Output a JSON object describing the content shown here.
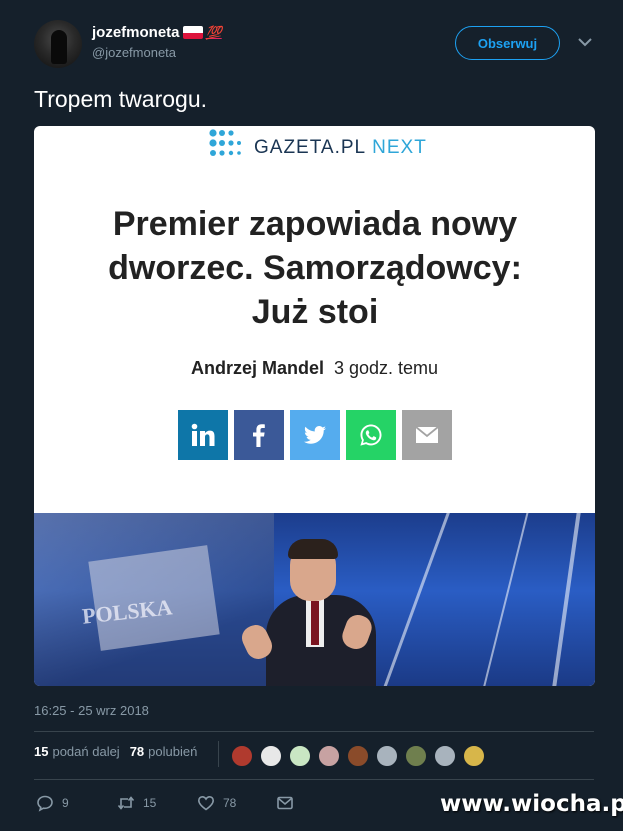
{
  "author": {
    "display_name": "jozefmoneta",
    "hundred_emoji": "💯",
    "handle": "@jozefmoneta"
  },
  "follow_button": "Obserwuj",
  "tweet_text": "Tropem twarogu.",
  "card": {
    "logo_main": "GAZETA.PL",
    "logo_next": "NEXT",
    "headline_lines": [
      "Premier zapowiada nowy",
      "dworzec. Samorządowcy:",
      "Już stoi"
    ],
    "author": "Andrzej Mandel",
    "time_ago": "3 godz. temu",
    "share_buttons": [
      {
        "icon": "linkedin-icon",
        "color": "#0e76a8"
      },
      {
        "icon": "facebook-icon",
        "color": "#3b5998"
      },
      {
        "icon": "twitter-icon",
        "color": "#55acee"
      },
      {
        "icon": "whatsapp-icon",
        "color": "#25d366"
      },
      {
        "icon": "email-icon",
        "color": "#a3a3a3"
      }
    ],
    "image_text": "POLSKA"
  },
  "timestamp": "16:25 - 25 wrz 2018",
  "stats": {
    "retweets_count": "15",
    "retweets_label": "podań dalej",
    "likes_count": "78",
    "likes_label": "polubień"
  },
  "actions": {
    "replies": "9",
    "retweets": "15",
    "likes": "78"
  },
  "watermark": "www.wiocha.pl",
  "colors": {
    "background": "#15202b",
    "accent": "#1da1f2",
    "muted": "#8899a6"
  }
}
